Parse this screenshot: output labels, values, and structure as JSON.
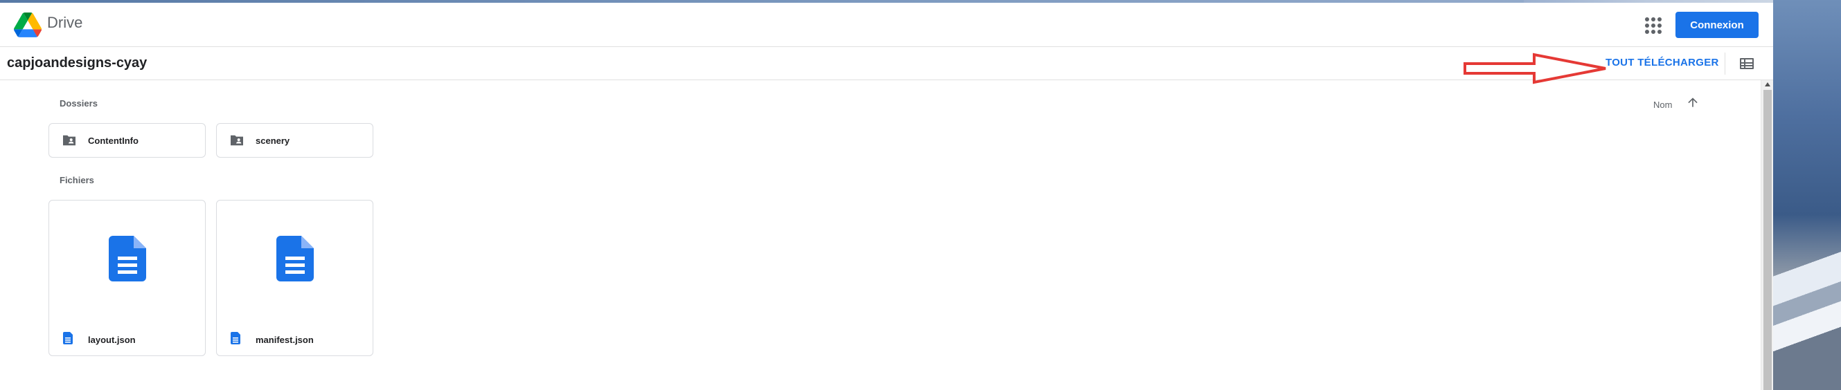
{
  "header": {
    "brand": "Drive",
    "signin_label": "Connexion"
  },
  "toolbar": {
    "folder_title": "capjoandesigns-cyay",
    "download_all_label": "TOUT TÉLÉCHARGER"
  },
  "sections": {
    "folders_label": "Dossiers",
    "files_label": "Fichiers",
    "sort_label": "Nom"
  },
  "folders": [
    {
      "name": "ContentInfo"
    },
    {
      "name": "scenery"
    }
  ],
  "files": [
    {
      "name": "layout.json"
    },
    {
      "name": "manifest.json"
    }
  ],
  "colors": {
    "accent": "#1a73e8",
    "annotation_arrow": "#e53935"
  },
  "icons": {
    "logo": "google-drive-logo",
    "apps": "apps-grid-icon",
    "list_view": "list-view-icon",
    "sort": "arrow-up-icon",
    "folder": "shared-folder-icon",
    "file": "document-icon"
  }
}
